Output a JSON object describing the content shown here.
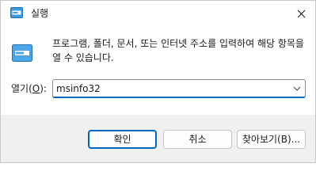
{
  "window": {
    "title": "실행",
    "close_glyph": "✕"
  },
  "body": {
    "description": "프로그램, 폴더, 문서, 또는 인터넷 주소를 입력하여 해당 항목을 열 수 있습니다.",
    "open_label_prefix": "열기(",
    "open_label_accel": "O",
    "open_label_suffix": "):",
    "open_value": "msinfo32"
  },
  "buttons": {
    "ok": "확인",
    "cancel": "취소",
    "browse": "찾아보기(B)..."
  },
  "colors": {
    "accent": "#0067c0",
    "footer_bg": "#f0f0f0"
  },
  "icons": {
    "title": "run-icon",
    "close": "close-icon",
    "main": "run-icon",
    "dropdown": "chevron-down-icon"
  }
}
